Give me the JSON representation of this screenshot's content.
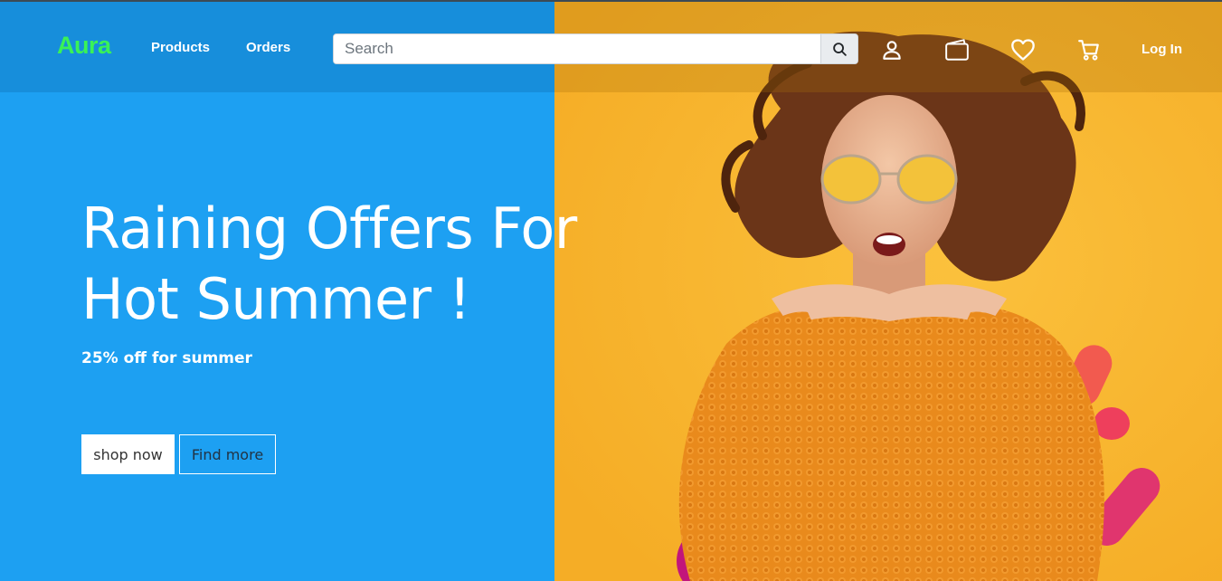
{
  "colors": {
    "left_bg": "#1da0f2",
    "right_bg": "#f8b72f",
    "brand": "#39f257"
  },
  "navbar": {
    "brand": "Aura",
    "links": [
      "Products",
      "Orders"
    ],
    "search_placeholder": "Search",
    "icons": [
      "user-icon",
      "wallet-icon",
      "heart-icon",
      "cart-icon"
    ],
    "login_label": "Log In"
  },
  "hero": {
    "headline_line1": "Raining Offers For",
    "headline_line2": "Hot Summer !",
    "subline": "25% off for summer",
    "shop_label": "shop now",
    "find_label": "Find more"
  }
}
